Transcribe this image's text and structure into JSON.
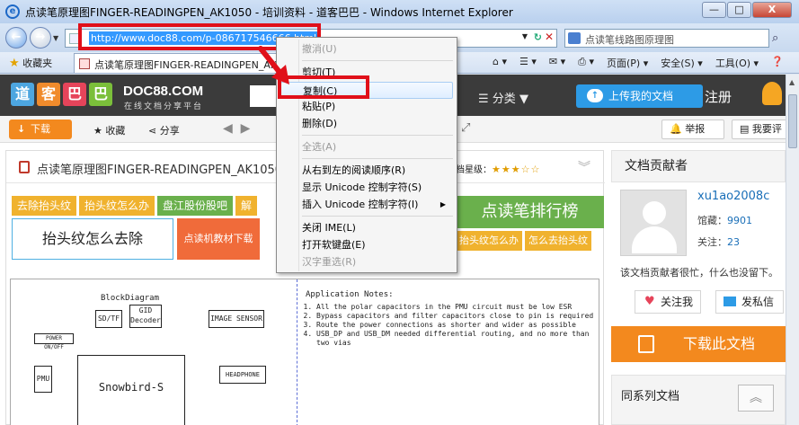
{
  "window": {
    "title": "点读笔原理图FINGER-READINGPEN_AK1050 - 培训资料 - 道客巴巴 - Windows Internet Explorer",
    "min": "—",
    "max": "□",
    "close": "X"
  },
  "address": {
    "url": "http://www.doc88.com/p-086717546666.html",
    "search_value": "点读笔线路图原理图"
  },
  "favbar": {
    "favorites": "收藏夹",
    "tab_title": "点读笔原理图FINGER-READINGPEN_AK1050",
    "tools": [
      "页面(P) ▾",
      "安全(S) ▾",
      "工具(O) ▾"
    ]
  },
  "site": {
    "logo": [
      "道",
      "客",
      "巴",
      "巴"
    ],
    "brand": "DOC88.COM",
    "brand_sub": "在线文档分享平台",
    "category": "分类",
    "upload": "上传我的文档",
    "register": "注册"
  },
  "toolbar": {
    "download": "下载",
    "collect": "收藏",
    "share": "分享",
    "report": "举报",
    "comment": "我要评"
  },
  "doc": {
    "title": "点读笔原理图FINGER-READINGPEN_AK1050",
    "level_label": "档星级：",
    "stars": "★★★☆☆",
    "ads_row1": [
      "去除抬头纹",
      "抬头纹怎么办",
      "盘江股份股吧",
      "解"
    ],
    "big_ad": "抬头纹怎么去除",
    "orange_ad": "点读机教材下载",
    "green_ad": "点读笔排行榜",
    "small_ads": [
      "抬头纹怎么办",
      "怎么去抬头纹"
    ]
  },
  "diagram": {
    "block_title": "BlockDiagram",
    "blocks": [
      "SD/TF",
      "GID Decoder",
      "IMAGE SENSOR",
      "POWER ON/OFF",
      "PMU",
      "Snowbird-S",
      "HEADPHONE"
    ],
    "notes_title": "Application Notes:",
    "notes": [
      "All the polar capacitors in the PMU circuit must be low ESR",
      "Bypass capacitors and filter capacitors close to pin is required",
      "Route the power connections as shorter and wider as possible",
      "USB_DP and USB_DM needed differential routing, and no more than two vias"
    ]
  },
  "sidebar": {
    "contributor_header": "文档贡献者",
    "username": "xu1ao2008c",
    "library_label": "馆藏：",
    "library_count": "9901",
    "follow_label": "关注：",
    "follow_count": "23",
    "lazy_text": "该文档贡献者很忙，什么也没留下。",
    "follow_btn": "关注我",
    "message_btn": "发私信",
    "download_doc": "下载此文档",
    "series": "同系列文档"
  },
  "context_menu": {
    "items": [
      {
        "label": "撤消(U)",
        "disabled": true
      },
      {
        "label": "剪切(T)",
        "disabled": false
      },
      {
        "label": "复制(C)",
        "disabled": false,
        "highlight": true
      },
      {
        "label": "粘贴(P)",
        "disabled": false
      },
      {
        "label": "删除(D)",
        "disabled": false
      },
      {
        "label": "全选(A)",
        "disabled": true
      },
      {
        "label": "从右到左的阅读顺序(R)",
        "disabled": false
      },
      {
        "label": "显示 Unicode 控制字符(S)",
        "disabled": false
      },
      {
        "label": "插入 Unicode 控制字符(I)",
        "disabled": false,
        "submenu": true
      },
      {
        "label": "关闭 IME(L)",
        "disabled": false
      },
      {
        "label": "打开软键盘(E)",
        "disabled": false
      },
      {
        "label": "汉字重选(R)",
        "disabled": true
      }
    ]
  },
  "colors": {
    "annotation_red": "#e0101a",
    "site_dark": "#3b3b3b",
    "accent_orange": "#f3891e",
    "accent_blue": "#2d9be6"
  }
}
